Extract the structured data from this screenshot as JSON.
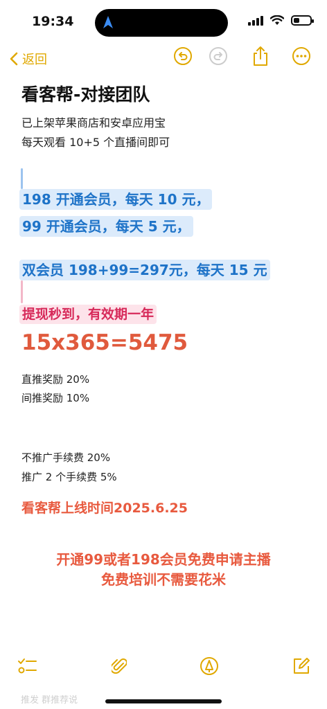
{
  "status": {
    "time": "19:34"
  },
  "nav": {
    "back_label": "返回"
  },
  "note": {
    "title": "看客帮-对接团队",
    "line1": "已上架苹果商店和安卓应用宝",
    "line2": "每天观看 10+5 个直播间即可",
    "blue1": "198 开通会员，每天 10 元，",
    "blue2": "99 开通会员，每天 5 元，",
    "blue3": "双会员 198+99=297元，每天 15 元",
    "pink1": "提现秒到，有效期一年",
    "formula": "15x365=5475",
    "reward1": "直推奖励 20%",
    "reward2": "间推奖励 10%",
    "fee1": "不推广手续费 20%",
    "fee2": "推广 2 个手续费 5%",
    "launch": "看客帮上线时间2025.6.25",
    "promo1": "开通99或者198会员免费申请主播",
    "promo2": "免费培训不需要花米",
    "faded": "推发 群推荐说"
  },
  "colors": {
    "accent": "#e0a800",
    "highlight_blue": "#1e73c8",
    "highlight_pink": "#d72a5a",
    "red": "#e85a3f"
  },
  "icons": {
    "back": "chevron-left-icon",
    "undo": "undo-icon",
    "redo": "redo-icon",
    "share": "share-icon",
    "more": "more-icon",
    "checklist": "checklist-icon",
    "attach": "paperclip-icon",
    "markup": "markup-pen-icon",
    "compose": "compose-icon"
  },
  "battery_level": 0.35
}
